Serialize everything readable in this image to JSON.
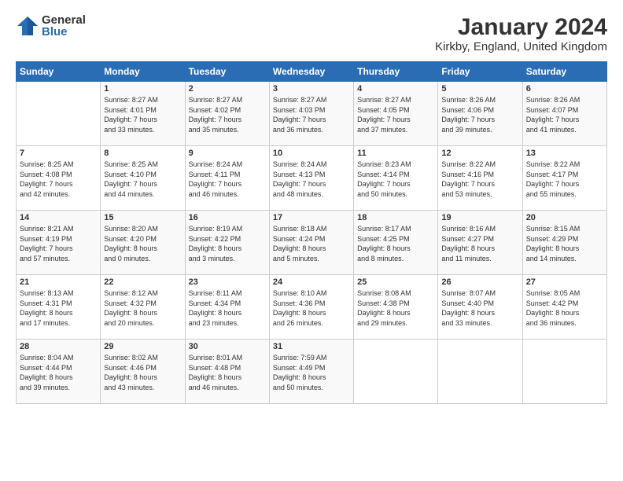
{
  "logo": {
    "general": "General",
    "blue": "Blue"
  },
  "title": "January 2024",
  "location": "Kirkby, England, United Kingdom",
  "weekdays": [
    "Sunday",
    "Monday",
    "Tuesday",
    "Wednesday",
    "Thursday",
    "Friday",
    "Saturday"
  ],
  "weeks": [
    [
      {
        "day": "",
        "info": ""
      },
      {
        "day": "1",
        "info": "Sunrise: 8:27 AM\nSunset: 4:01 PM\nDaylight: 7 hours\nand 33 minutes."
      },
      {
        "day": "2",
        "info": "Sunrise: 8:27 AM\nSunset: 4:02 PM\nDaylight: 7 hours\nand 35 minutes."
      },
      {
        "day": "3",
        "info": "Sunrise: 8:27 AM\nSunset: 4:03 PM\nDaylight: 7 hours\nand 36 minutes."
      },
      {
        "day": "4",
        "info": "Sunrise: 8:27 AM\nSunset: 4:05 PM\nDaylight: 7 hours\nand 37 minutes."
      },
      {
        "day": "5",
        "info": "Sunrise: 8:26 AM\nSunset: 4:06 PM\nDaylight: 7 hours\nand 39 minutes."
      },
      {
        "day": "6",
        "info": "Sunrise: 8:26 AM\nSunset: 4:07 PM\nDaylight: 7 hours\nand 41 minutes."
      }
    ],
    [
      {
        "day": "7",
        "info": "Sunrise: 8:25 AM\nSunset: 4:08 PM\nDaylight: 7 hours\nand 42 minutes."
      },
      {
        "day": "8",
        "info": "Sunrise: 8:25 AM\nSunset: 4:10 PM\nDaylight: 7 hours\nand 44 minutes."
      },
      {
        "day": "9",
        "info": "Sunrise: 8:24 AM\nSunset: 4:11 PM\nDaylight: 7 hours\nand 46 minutes."
      },
      {
        "day": "10",
        "info": "Sunrise: 8:24 AM\nSunset: 4:13 PM\nDaylight: 7 hours\nand 48 minutes."
      },
      {
        "day": "11",
        "info": "Sunrise: 8:23 AM\nSunset: 4:14 PM\nDaylight: 7 hours\nand 50 minutes."
      },
      {
        "day": "12",
        "info": "Sunrise: 8:22 AM\nSunset: 4:16 PM\nDaylight: 7 hours\nand 53 minutes."
      },
      {
        "day": "13",
        "info": "Sunrise: 8:22 AM\nSunset: 4:17 PM\nDaylight: 7 hours\nand 55 minutes."
      }
    ],
    [
      {
        "day": "14",
        "info": "Sunrise: 8:21 AM\nSunset: 4:19 PM\nDaylight: 7 hours\nand 57 minutes."
      },
      {
        "day": "15",
        "info": "Sunrise: 8:20 AM\nSunset: 4:20 PM\nDaylight: 8 hours\nand 0 minutes."
      },
      {
        "day": "16",
        "info": "Sunrise: 8:19 AM\nSunset: 4:22 PM\nDaylight: 8 hours\nand 3 minutes."
      },
      {
        "day": "17",
        "info": "Sunrise: 8:18 AM\nSunset: 4:24 PM\nDaylight: 8 hours\nand 5 minutes."
      },
      {
        "day": "18",
        "info": "Sunrise: 8:17 AM\nSunset: 4:25 PM\nDaylight: 8 hours\nand 8 minutes."
      },
      {
        "day": "19",
        "info": "Sunrise: 8:16 AM\nSunset: 4:27 PM\nDaylight: 8 hours\nand 11 minutes."
      },
      {
        "day": "20",
        "info": "Sunrise: 8:15 AM\nSunset: 4:29 PM\nDaylight: 8 hours\nand 14 minutes."
      }
    ],
    [
      {
        "day": "21",
        "info": "Sunrise: 8:13 AM\nSunset: 4:31 PM\nDaylight: 8 hours\nand 17 minutes."
      },
      {
        "day": "22",
        "info": "Sunrise: 8:12 AM\nSunset: 4:32 PM\nDaylight: 8 hours\nand 20 minutes."
      },
      {
        "day": "23",
        "info": "Sunrise: 8:11 AM\nSunset: 4:34 PM\nDaylight: 8 hours\nand 23 minutes."
      },
      {
        "day": "24",
        "info": "Sunrise: 8:10 AM\nSunset: 4:36 PM\nDaylight: 8 hours\nand 26 minutes."
      },
      {
        "day": "25",
        "info": "Sunrise: 8:08 AM\nSunset: 4:38 PM\nDaylight: 8 hours\nand 29 minutes."
      },
      {
        "day": "26",
        "info": "Sunrise: 8:07 AM\nSunset: 4:40 PM\nDaylight: 8 hours\nand 33 minutes."
      },
      {
        "day": "27",
        "info": "Sunrise: 8:05 AM\nSunset: 4:42 PM\nDaylight: 8 hours\nand 36 minutes."
      }
    ],
    [
      {
        "day": "28",
        "info": "Sunrise: 8:04 AM\nSunset: 4:44 PM\nDaylight: 8 hours\nand 39 minutes."
      },
      {
        "day": "29",
        "info": "Sunrise: 8:02 AM\nSunset: 4:46 PM\nDaylight: 8 hours\nand 43 minutes."
      },
      {
        "day": "30",
        "info": "Sunrise: 8:01 AM\nSunset: 4:48 PM\nDaylight: 8 hours\nand 46 minutes."
      },
      {
        "day": "31",
        "info": "Sunrise: 7:59 AM\nSunset: 4:49 PM\nDaylight: 8 hours\nand 50 minutes."
      },
      {
        "day": "",
        "info": ""
      },
      {
        "day": "",
        "info": ""
      },
      {
        "day": "",
        "info": ""
      }
    ]
  ]
}
